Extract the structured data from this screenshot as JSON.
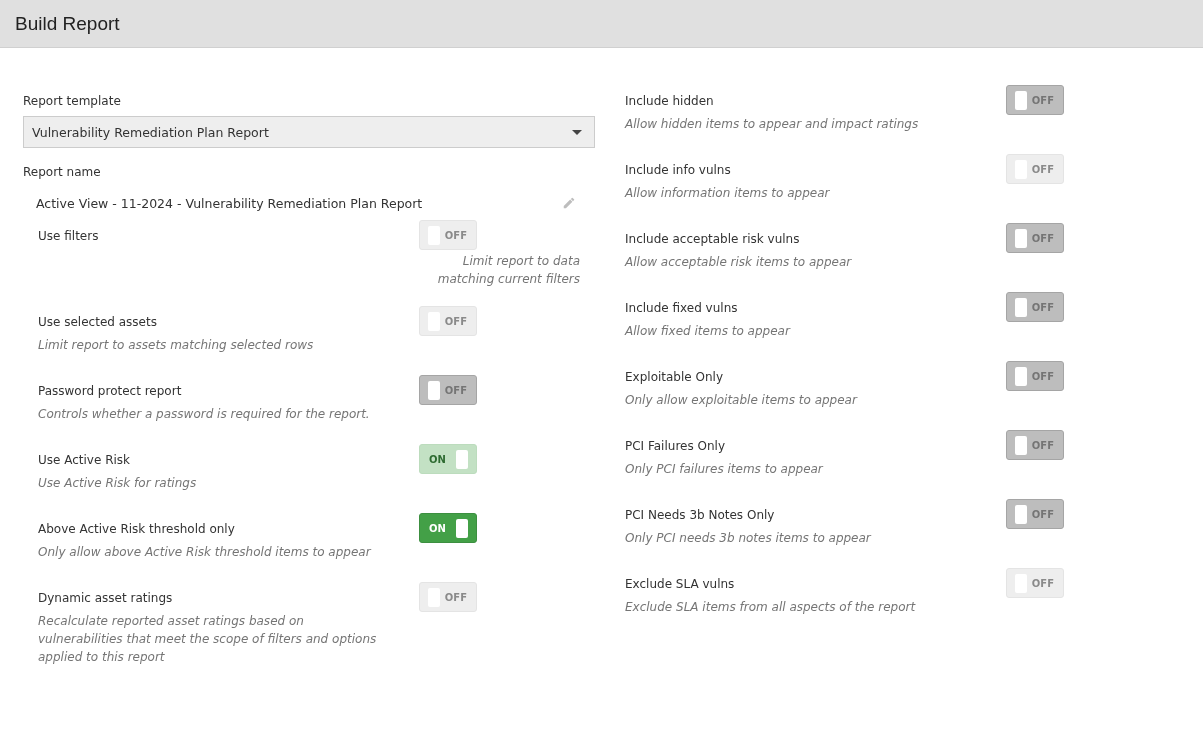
{
  "window": {
    "title": "Build Report"
  },
  "report_template": {
    "label": "Report template",
    "value": "Vulnerability Remediation Plan Report"
  },
  "report_name": {
    "label": "Report name",
    "value": "Active View - 11-2024 - Vulnerability Remediation Plan Report"
  },
  "left_options": [
    {
      "kind": "under-switch",
      "label": "Use filters",
      "description": "Limit report to data matching current filters",
      "switch": {
        "text": "OFF",
        "on": false,
        "disabled": true
      }
    },
    {
      "kind": "standard",
      "label": "Use selected assets",
      "description": "Limit report to assets matching selected rows",
      "switch": {
        "text": "OFF",
        "on": false,
        "disabled": true
      }
    },
    {
      "kind": "standard",
      "label": "Password protect report",
      "description": "Controls whether a password is required for the report.",
      "switch": {
        "text": "OFF",
        "on": false,
        "disabled": false
      }
    },
    {
      "kind": "standard",
      "label": "Use Active Risk",
      "description": "Use Active Risk for ratings",
      "switch": {
        "text": "ON",
        "on": true,
        "disabled": true
      }
    },
    {
      "kind": "standard",
      "label": "Above Active Risk threshold only",
      "description": "Only allow above Active Risk threshold items to appear",
      "switch": {
        "text": "ON",
        "on": true,
        "disabled": false
      }
    },
    {
      "kind": "standard",
      "label": "Dynamic asset ratings",
      "description": "Recalculate reported asset ratings based on vulnerabilities that meet the scope of filters and options applied to this report",
      "switch": {
        "text": "OFF",
        "on": false,
        "disabled": true
      }
    }
  ],
  "right_options": [
    {
      "kind": "standard",
      "label": "Include hidden",
      "description": "Allow hidden items to appear and impact ratings",
      "switch": {
        "text": "OFF",
        "on": false,
        "disabled": false
      }
    },
    {
      "kind": "standard",
      "label": "Include info vulns",
      "description": "Allow information items to appear",
      "switch": {
        "text": "OFF",
        "on": false,
        "disabled": true
      }
    },
    {
      "kind": "standard",
      "label": "Include acceptable risk vulns",
      "description": "Allow acceptable risk items to appear",
      "switch": {
        "text": "OFF",
        "on": false,
        "disabled": false
      }
    },
    {
      "kind": "standard",
      "label": "Include fixed vulns",
      "description": "Allow fixed items to appear",
      "switch": {
        "text": "OFF",
        "on": false,
        "disabled": false
      }
    },
    {
      "kind": "standard",
      "label": "Exploitable Only",
      "description": "Only allow exploitable items to appear",
      "switch": {
        "text": "OFF",
        "on": false,
        "disabled": false
      }
    },
    {
      "kind": "standard",
      "label": "PCI Failures Only",
      "description": "Only PCI failures items to appear",
      "switch": {
        "text": "OFF",
        "on": false,
        "disabled": false
      }
    },
    {
      "kind": "standard",
      "label": "PCI Needs 3b Notes Only",
      "description": "Only PCI needs 3b notes items to appear",
      "switch": {
        "text": "OFF",
        "on": false,
        "disabled": false
      }
    },
    {
      "kind": "standard",
      "label": "Exclude SLA vulns",
      "description": "Exclude SLA items from all aspects of the report",
      "switch": {
        "text": "OFF",
        "on": false,
        "disabled": true
      }
    }
  ]
}
